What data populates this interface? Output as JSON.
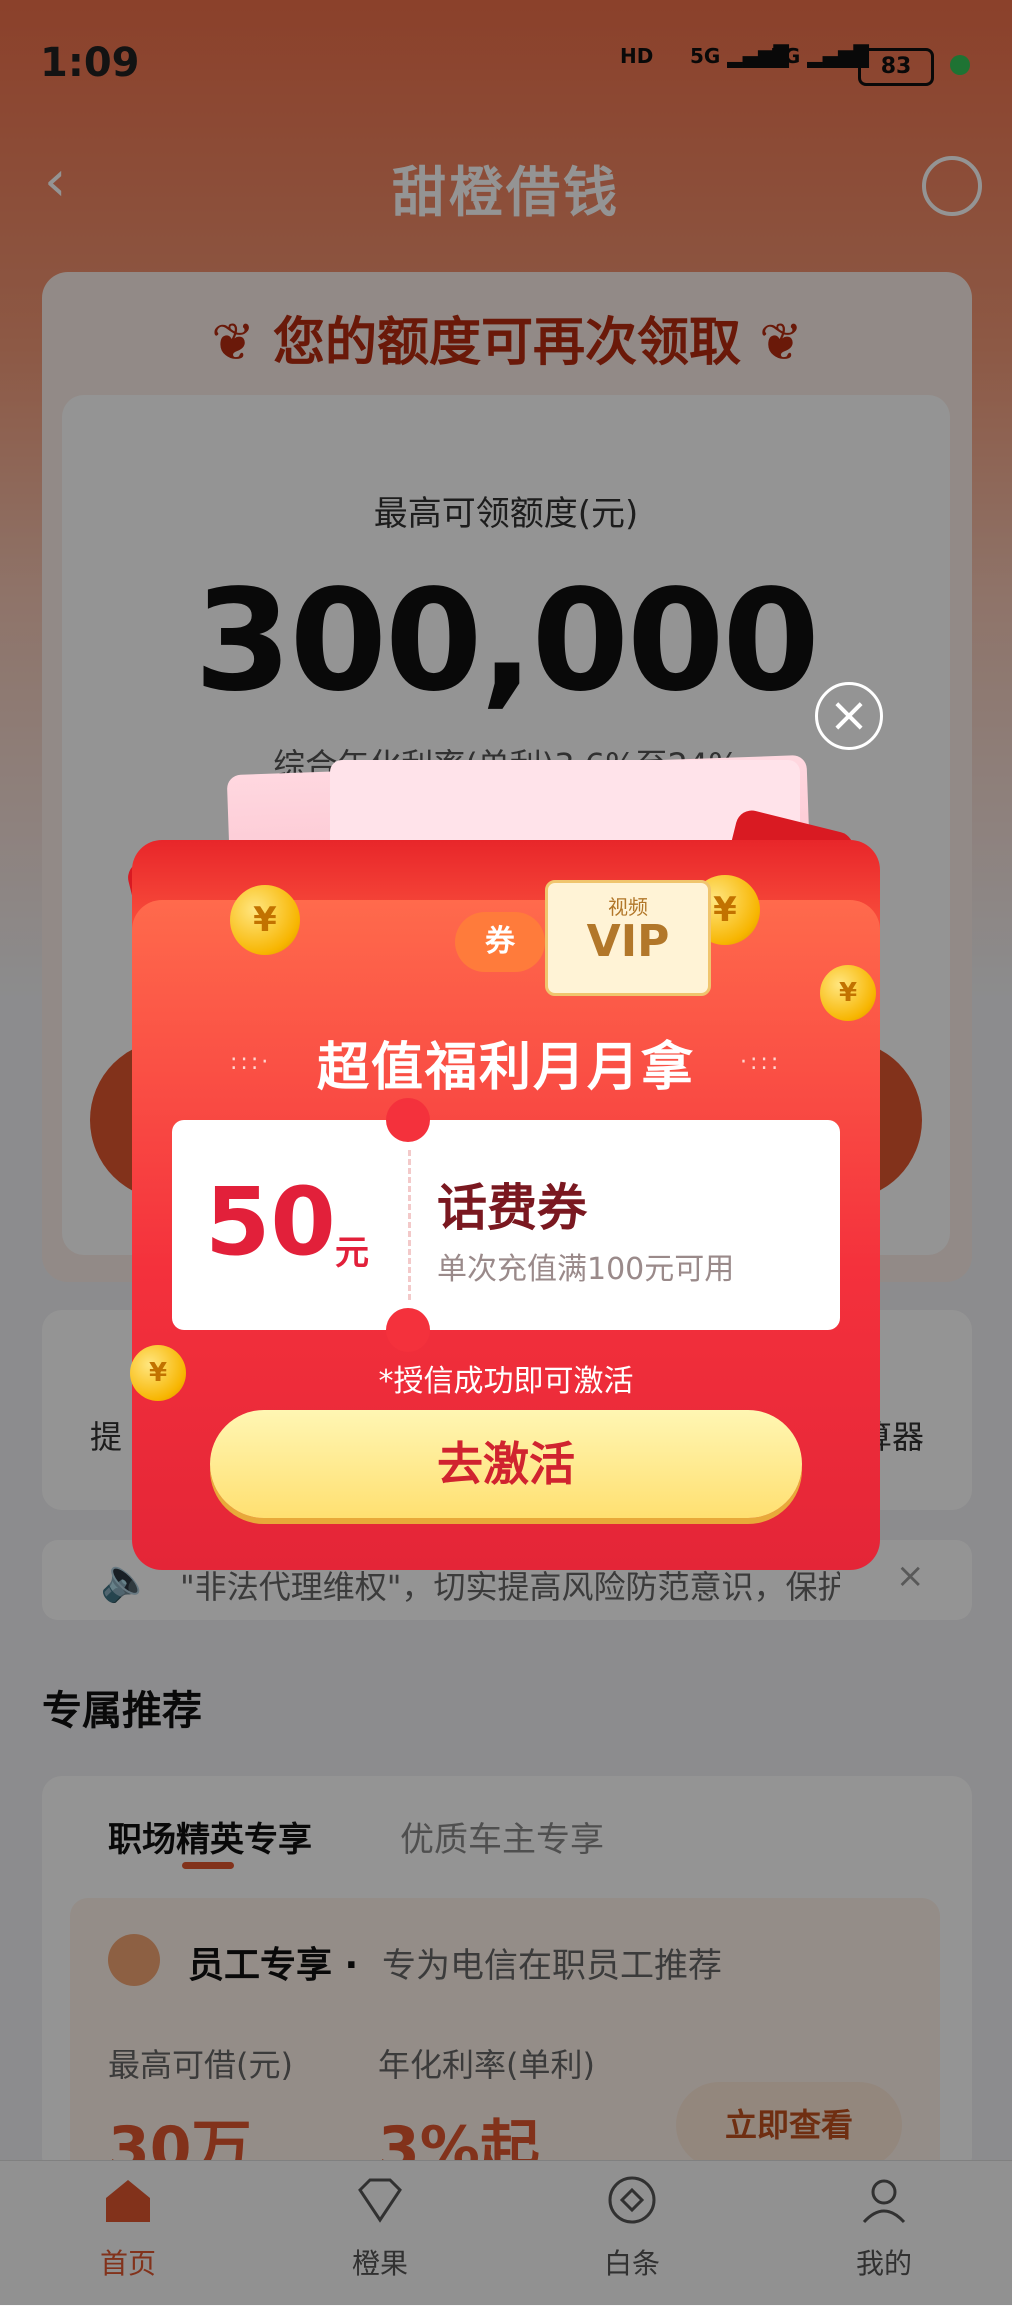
{
  "status_bar": {
    "time": "1:09",
    "hd": "HD",
    "net1": "5G",
    "net2": "5G",
    "battery": "83"
  },
  "nav": {
    "title": "甜橙借钱",
    "back_icon": "chevron-left-icon",
    "service_icon": "headset-icon"
  },
  "hero": {
    "ribbon": "您的额度可再次领取",
    "limit_label": "最高可领额度(元)",
    "limit_value": "300,000",
    "rate_text": "综合年化利率(单利)3.6%至24%"
  },
  "quick_actions": {
    "left_partial": "提",
    "right_partial": "算器"
  },
  "notice": {
    "text": "\"非法代理维权\"，切实提高风险防范意识，保护",
    "close": "×"
  },
  "recommend": {
    "title": "专属推荐",
    "tabs": [
      "职场精英专享",
      "优质车主专享"
    ],
    "card": {
      "title": "员工专享 ·",
      "subtitle": "专为电信在职员工推荐",
      "label1": "最高可借(元)",
      "label2": "年化利率(单利)",
      "value1": "30万",
      "value2": "3%起",
      "button": "立即查看"
    }
  },
  "tabbar": [
    {
      "label": "首页",
      "icon": "home-icon",
      "active": true
    },
    {
      "label": "橙果",
      "icon": "gem-icon",
      "active": false
    },
    {
      "label": "白条",
      "icon": "diamond-circle-icon",
      "active": false
    },
    {
      "label": "我的",
      "icon": "user-icon",
      "active": false
    }
  ],
  "popup": {
    "heading": "超值福利月月拿",
    "vip_small": "视频",
    "vip_big": "VIP",
    "coupon_chip": "券",
    "coupon": {
      "amount": "50",
      "unit": "元",
      "name": "话费券",
      "desc": "单次充值满100元可用"
    },
    "note": "*授信成功即可激活",
    "button": "去激活",
    "close": "×"
  },
  "colors": {
    "brand": "#e0562f",
    "popup_red": "#f4313c",
    "button_yellow": "#ffe071"
  }
}
